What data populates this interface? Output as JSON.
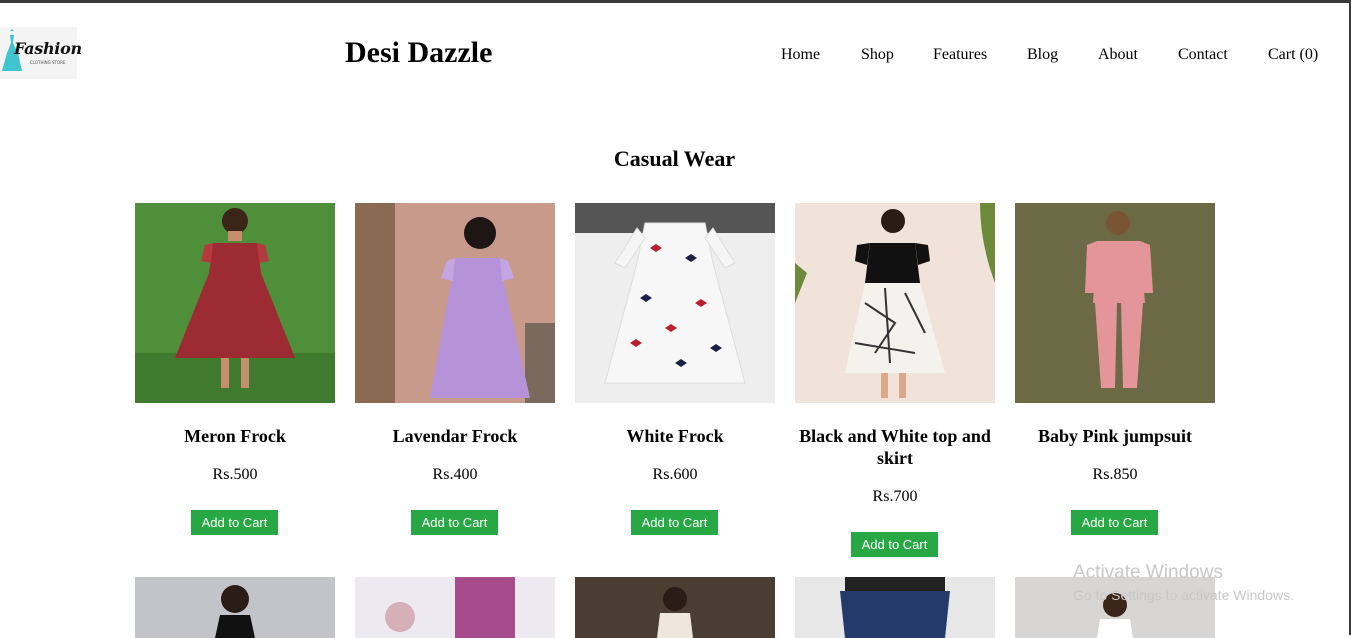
{
  "header": {
    "logo_text": "Fashion",
    "logo_sub": "CLOTHING STORE",
    "brand": "Desi Dazzle",
    "nav": [
      "Home",
      "Shop",
      "Features",
      "Blog",
      "About",
      "Contact",
      "Cart (0)"
    ]
  },
  "section": {
    "title": "Casual Wear"
  },
  "products": [
    {
      "name": "Meron Frock",
      "price": "Rs.500",
      "button": "Add to Cart"
    },
    {
      "name": "Lavendar Frock",
      "price": "Rs.400",
      "button": "Add to Cart"
    },
    {
      "name": "White Frock",
      "price": "Rs.600",
      "button": "Add to Cart"
    },
    {
      "name": "Black and White top and skirt",
      "price": "Rs.700",
      "button": "Add to Cart"
    },
    {
      "name": "Baby Pink jumpsuit",
      "price": "Rs.850",
      "button": "Add to Cart"
    }
  ],
  "watermark": {
    "line1": "Activate Windows",
    "line2": "Go to Settings to activate Windows."
  },
  "colors": {
    "button": "#28a745",
    "border": "#3a3a3a"
  }
}
